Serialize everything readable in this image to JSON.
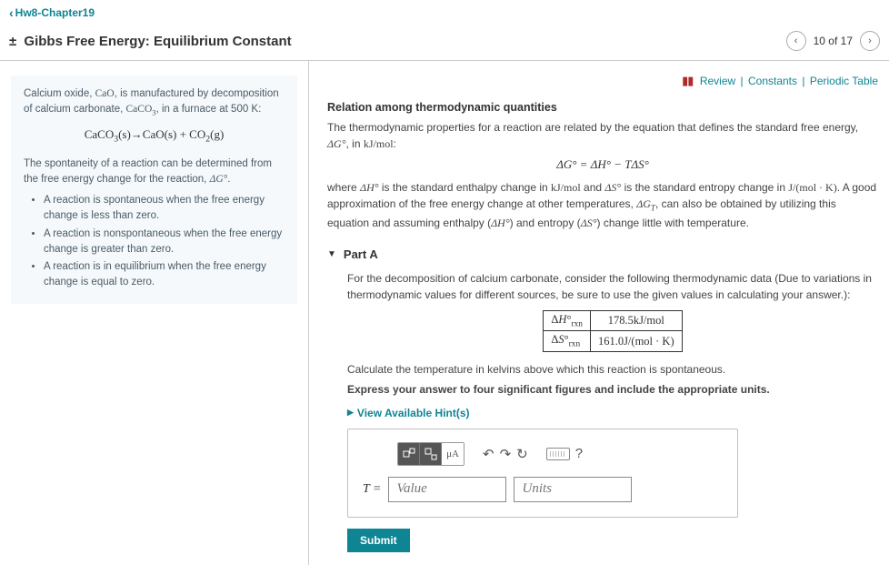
{
  "breadcrumb_label": "Hw8-Chapter19",
  "page_title": "Gibbs Free Energy: Equilibrium Constant",
  "progress": "10 of 17",
  "top_links": {
    "review": "Review",
    "constants": "Constants",
    "periodic": "Periodic Table"
  },
  "infobox": {
    "intro_pre": "Calcium oxide, ",
    "cao": "CaO",
    "intro_mid": ", is manufactured by decomposition of calcium carbonate, ",
    "caco3": "CaCO",
    "intro_post": ", in a furnace at 500 K:",
    "sponte_pre": "The spontaneity of a reaction can be determined from the free energy change for the reaction, ",
    "dg": "ΔG°",
    "period": ".",
    "bullets": [
      "A reaction is spontaneous when the free energy change is less than zero.",
      "A reaction is nonspontaneous when the free energy change is greater than zero.",
      "A reaction is in equilibrium when the free energy change is equal to zero."
    ]
  },
  "relation": {
    "heading": "Relation among thermodynamic quantities",
    "p1_pre": "The thermodynamic properties for a reaction are related by the equation that defines the standard free energy, ",
    "p1_post": ", in ",
    "kjmol": "kJ/mol",
    "colon": ":",
    "p2_a": "where ",
    "p2_b": " is the standard enthalpy change in ",
    "p2_c": " and ",
    "p2_d": " is the standard entropy change in ",
    "jmolk": "J/(mol · K)",
    "p2_e": ". A good approximation of the free energy change at other temperatures, ",
    "dgt": "ΔG",
    "p2_f": ", can also be obtained by utilizing this equation and assuming enthalpy (",
    "dh": "ΔH°",
    "p2_g": ") and entropy (",
    "ds": "ΔS°",
    "p2_h": ") change little with temperature."
  },
  "partA": {
    "label": "Part A",
    "q1": "For the decomposition of calcium carbonate, consider the following thermodynamic data (Due to variations in thermodynamic values for different sources, be sure to use the given values in calculating your answer.):",
    "row1_val": "178.5kJ/mol",
    "row2_val": "161.0J/(mol · K)",
    "q2": "Calculate the temperature in kelvins above which this reaction is spontaneous.",
    "q3": "Express your answer to four significant figures and include the appropriate units.",
    "hints": "View Available Hint(s)",
    "Teq": "T =",
    "value_ph": "Value",
    "units_ph": "Units",
    "submit": "Submit"
  },
  "icons": {
    "prev": "‹",
    "next": "›",
    "tri_down": "▼",
    "tri_right": "▶",
    "undo": "↶",
    "redo": "↷",
    "reset": "↻",
    "help": "?",
    "mu_a": "μA"
  }
}
